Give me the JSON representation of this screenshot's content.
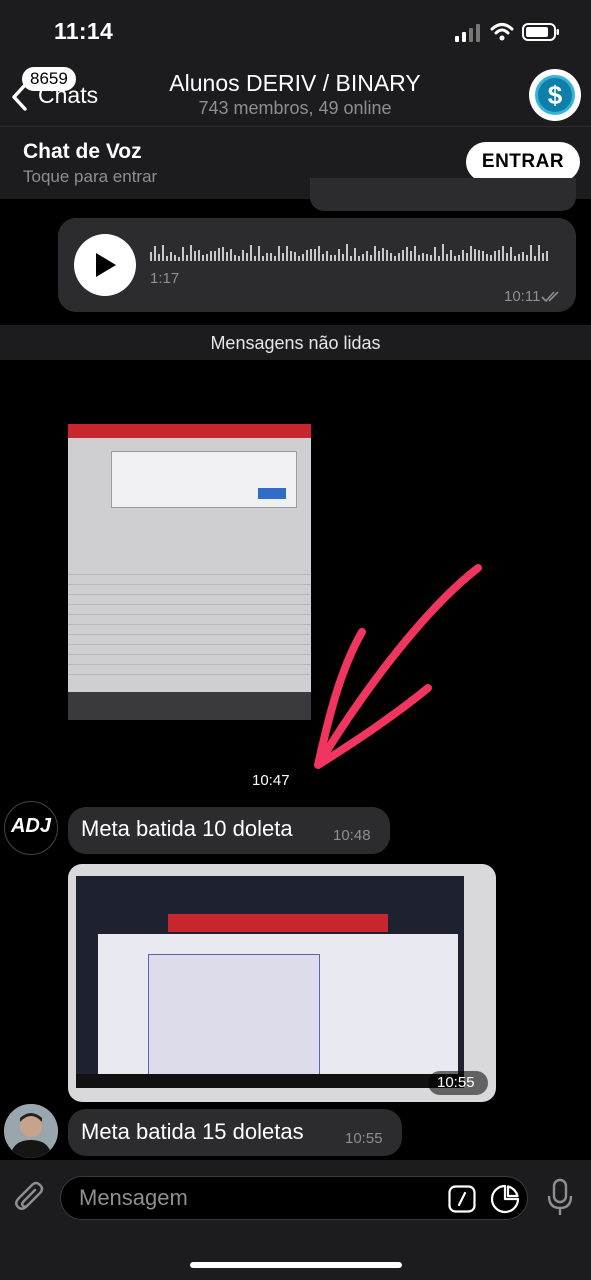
{
  "status_bar": {
    "time": "11:14"
  },
  "nav": {
    "back_label": "Chats",
    "unread_count": "8659",
    "title": "Alunos DERIV / BINARY",
    "subtitle": "743 membros, 49 online",
    "avatar_symbol": "$"
  },
  "voice_chat": {
    "title": "Chat de Voz",
    "subtitle": "Toque para entrar",
    "join_label": "ENTRAR"
  },
  "messages": {
    "voice": {
      "duration": "1:17",
      "time": "10:11"
    },
    "unread_divider": "Mensagens não lidas",
    "photo1": {
      "time": "10:47"
    },
    "text1": {
      "avatar_text": "ADJ",
      "text": "Meta batida 10 doleta",
      "time": "10:48"
    },
    "photo2": {
      "time": "10:55"
    },
    "text2": {
      "text": "Meta batida 15 doletas",
      "time": "10:55"
    }
  },
  "composer": {
    "placeholder": "Mensagem"
  },
  "colors": {
    "background": "#000000",
    "bar": "#1c1c1e",
    "bubble": "#2c2c2e",
    "secondary_text": "#8e8e93",
    "arrow": "#f0355f"
  },
  "icons": [
    "signal-icon",
    "wifi-icon",
    "battery-icon",
    "chevron-left-icon",
    "dollar-icon",
    "play-icon",
    "double-check-icon",
    "paperclip-icon",
    "command-icon",
    "sticker-icon",
    "microphone-icon"
  ]
}
